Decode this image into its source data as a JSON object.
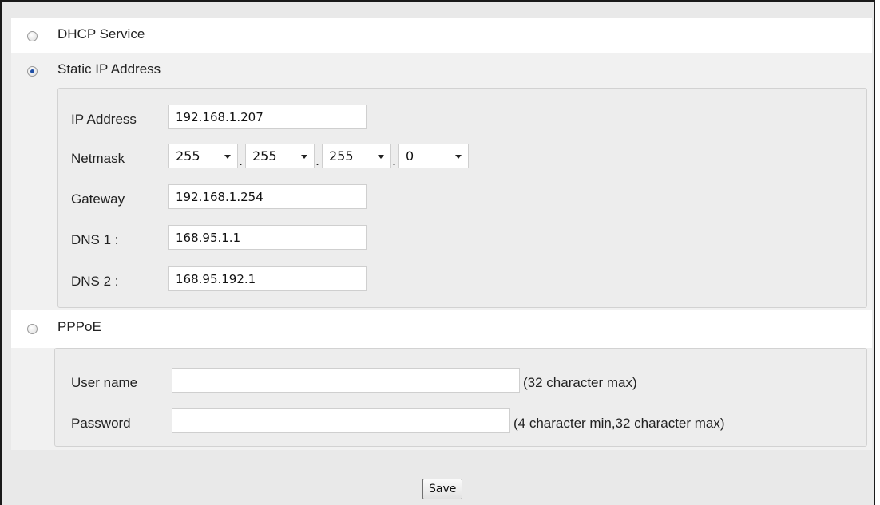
{
  "network_mode": {
    "dhcp": {
      "label": "DHCP Service",
      "selected": false
    },
    "static": {
      "label": "Static IP Address",
      "selected": true,
      "ip_address": {
        "label": "IP Address",
        "value": "192.168.1.207"
      },
      "netmask": {
        "label": "Netmask",
        "octets": [
          "255",
          "255",
          "255",
          "0"
        ]
      },
      "gateway": {
        "label": "Gateway",
        "value": "192.168.1.254"
      },
      "dns1": {
        "label": "DNS 1 :",
        "value": "168.95.1.1"
      },
      "dns2": {
        "label": "DNS 2 :",
        "value": "168.95.192.1"
      }
    },
    "pppoe": {
      "label": "PPPoE",
      "selected": false,
      "username": {
        "label": "User name",
        "value": "",
        "hint": "(32 character max)"
      },
      "password": {
        "label": "Password",
        "value": "",
        "hint": "(4 character min,32 character max)"
      }
    }
  },
  "actions": {
    "save_label": "Save"
  }
}
